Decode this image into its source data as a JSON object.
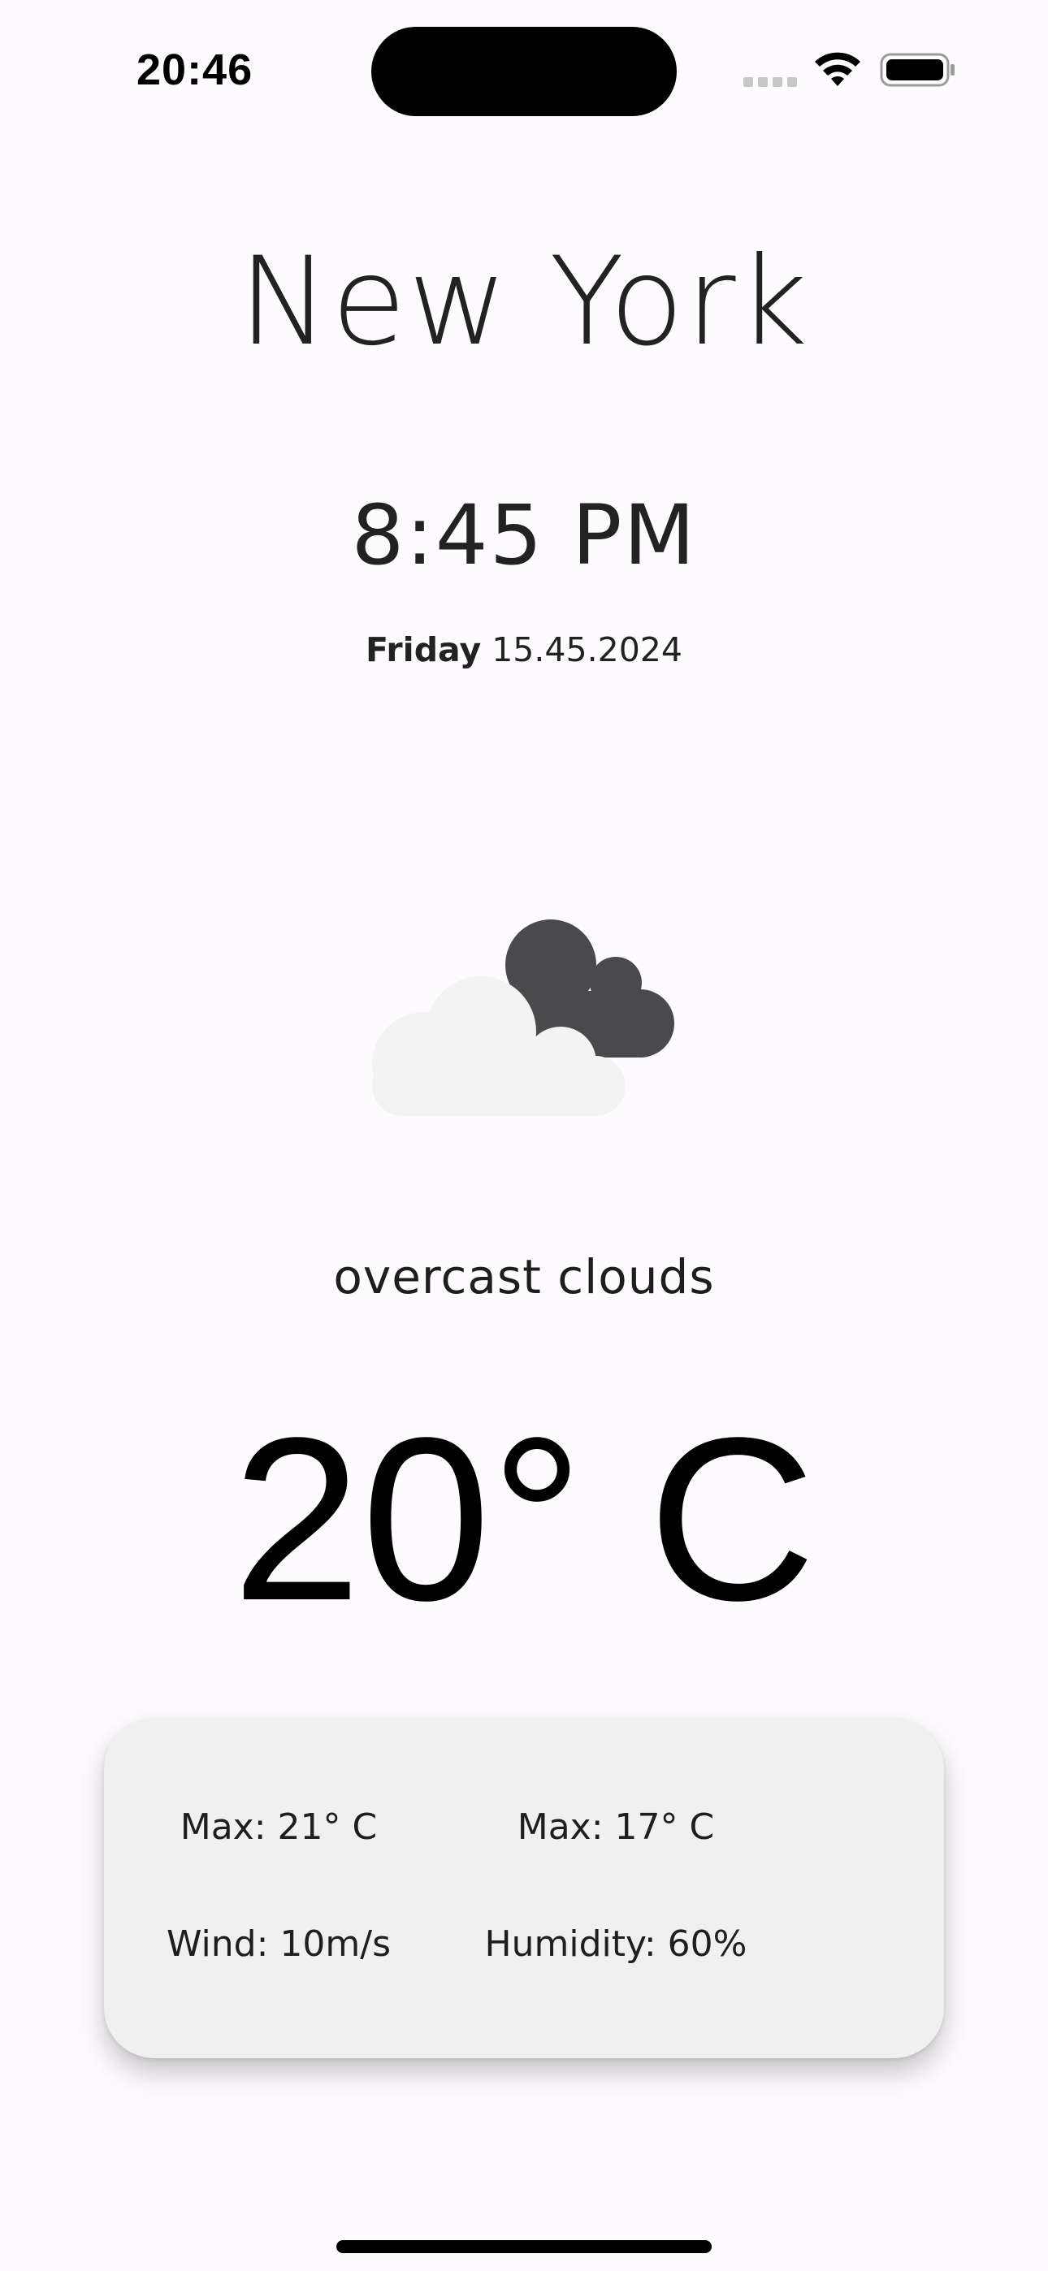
{
  "status_bar": {
    "time": "20:46",
    "icons": [
      "signal-icon",
      "wifi-icon",
      "battery-icon"
    ]
  },
  "weather": {
    "city": "New York",
    "time": "8:45 PM",
    "day": "Friday",
    "date": "15.45.2024",
    "icon": "overcast-clouds-icon",
    "condition": "overcast clouds",
    "temperature": "20° C"
  },
  "details": {
    "max_temp": "Max: 21° C",
    "min_temp": "Max: 17° C",
    "wind": "Wind: 10m/s",
    "humidity": "Humidity: 60%"
  },
  "colors": {
    "background": "#FEFBFF",
    "card": "#F0F0F0",
    "cloud_light": "#F2F3F2",
    "cloud_dark": "#4A494C"
  }
}
